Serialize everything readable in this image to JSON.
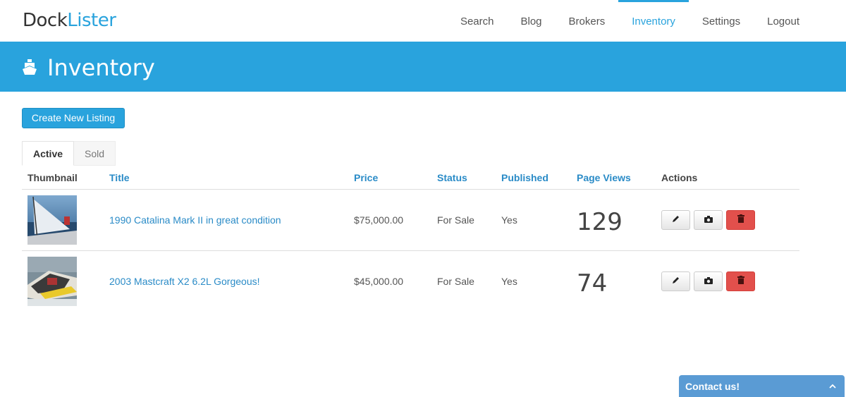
{
  "app": {
    "logo_part1": "Dock",
    "logo_part2": "Lister"
  },
  "nav": {
    "items": [
      {
        "label": "Search"
      },
      {
        "label": "Blog"
      },
      {
        "label": "Brokers"
      },
      {
        "label": "Inventory",
        "active": true
      },
      {
        "label": "Settings"
      },
      {
        "label": "Logout"
      }
    ]
  },
  "banner": {
    "icon": "boat-icon",
    "title": "Inventory"
  },
  "toolbar": {
    "create_label": "Create New Listing"
  },
  "tabs": [
    {
      "label": "Active",
      "active": true
    },
    {
      "label": "Sold",
      "active": false
    }
  ],
  "table": {
    "headers": [
      "Thumbnail",
      "Title",
      "Price",
      "Status",
      "Published",
      "Page Views",
      "Actions"
    ],
    "rows": [
      {
        "title": "1990 Catalina Mark II in great condition",
        "price": "$75,000.00",
        "status": "For Sale",
        "published": "Yes",
        "page_views": "129"
      },
      {
        "title": "2003 Mastcraft X2 6.2L Gorgeous!",
        "price": "$45,000.00",
        "status": "For Sale",
        "published": "Yes",
        "page_views": "74"
      }
    ],
    "action_icons": [
      "pencil-icon",
      "camera-icon",
      "trash-icon"
    ]
  },
  "contact": {
    "label": "Contact us!"
  },
  "colors": {
    "accent": "#29a3dd",
    "link": "#2a8bc7",
    "danger": "#e2504c",
    "contact_bg": "#5a9bd4"
  }
}
